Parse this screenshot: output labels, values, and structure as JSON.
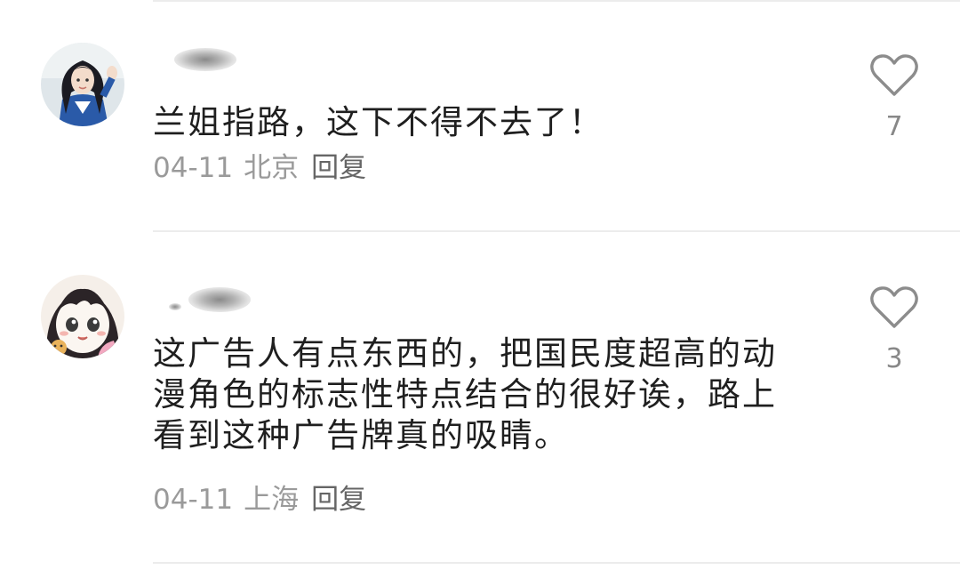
{
  "comments": [
    {
      "text": "兰姐指路，这下不得不去了！",
      "date": "04-11",
      "location": "北京",
      "reply_label": "回复",
      "like_count": "7",
      "icons": {
        "like": "heart-outline-icon"
      }
    },
    {
      "text": "这广告人有点东西的，把国民度超高的动漫角色的标志性特点结合的很好诶，路上看到这种广告牌真的吸睛。",
      "date": "04-11",
      "location": "上海",
      "reply_label": "回复",
      "like_count": "3",
      "icons": {
        "like": "heart-outline-icon"
      }
    }
  ],
  "colors": {
    "text": "#1f1f1f",
    "meta": "#9a9a9a",
    "reply": "#666666",
    "icon": "#8c8c8c",
    "divider": "#ececec"
  }
}
